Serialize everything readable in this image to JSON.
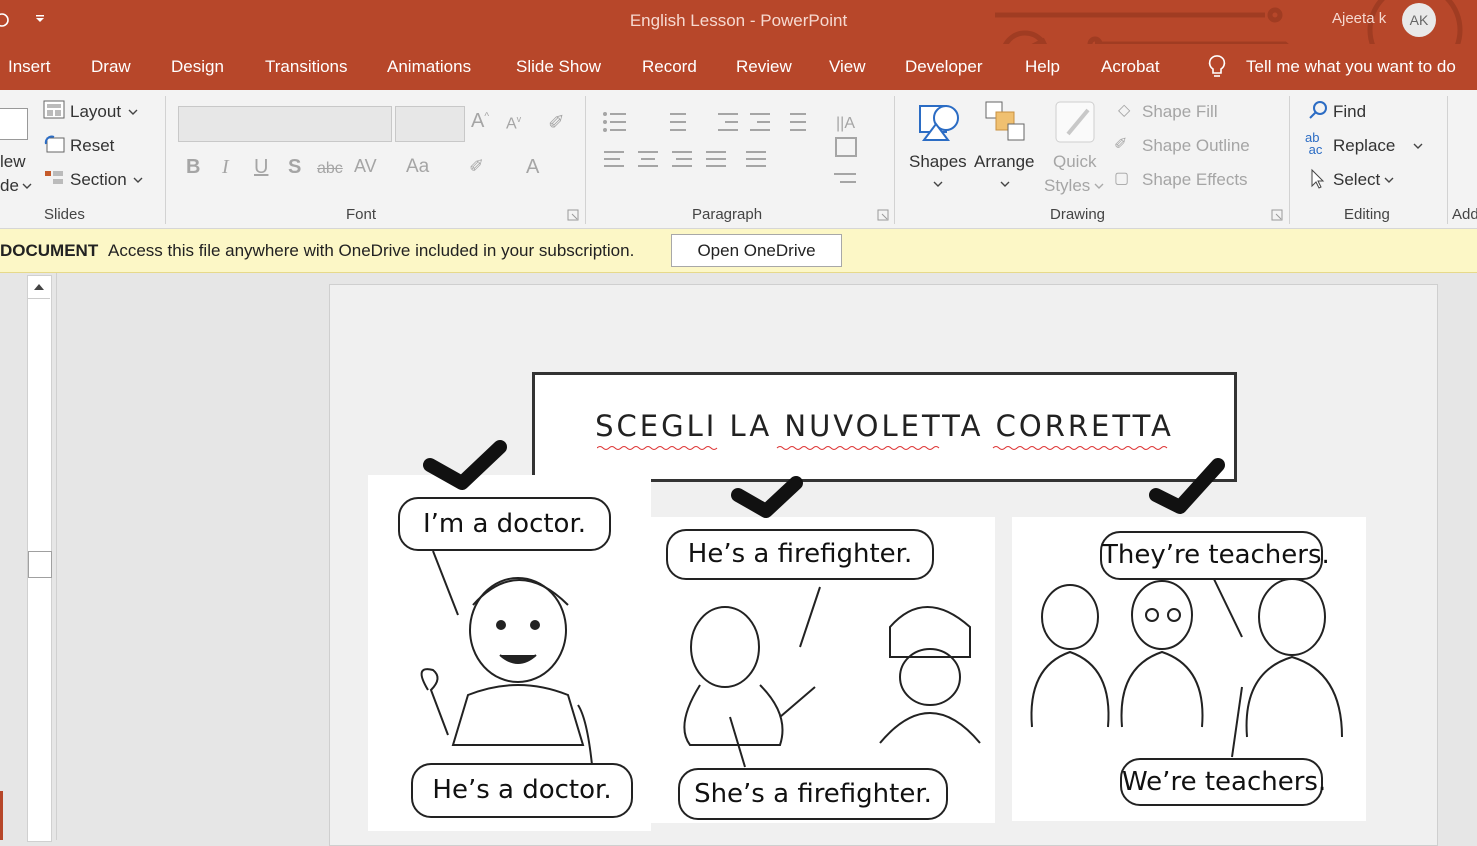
{
  "titlebar": {
    "title": "English Lesson  -  PowerPoint",
    "user_name": "Ajeeta k",
    "avatar_initials": "AK",
    "accent": "#b7472a"
  },
  "tabs": [
    "Insert",
    "Draw",
    "Design",
    "Transitions",
    "Animations",
    "Slide Show",
    "Record",
    "Review",
    "View",
    "Developer",
    "Help",
    "Acrobat"
  ],
  "tell_me": "Tell me what you want to do",
  "ribbon": {
    "slides": {
      "new_slide_line1": "lew",
      "new_slide_line2": "de",
      "layout": "Layout",
      "reset": "Reset",
      "section": "Section",
      "group_label": "Slides"
    },
    "font": {
      "bold": "B",
      "italic": "I",
      "underline": "U",
      "shadow": "S",
      "strike": "abc",
      "spacing": "AV",
      "case": "Aa",
      "color_a": "A",
      "group_label": "Font"
    },
    "paragraph": {
      "group_label": "Paragraph"
    },
    "drawing": {
      "shapes": "Shapes",
      "arrange": "Arrange",
      "quick_styles_1": "Quick",
      "quick_styles_2": "Styles",
      "shape_fill": "Shape Fill",
      "shape_outline": "Shape Outline",
      "shape_effects": "Shape Effects",
      "group_label": "Drawing"
    },
    "editing": {
      "find": "Find",
      "replace": "Replace",
      "select": "Select",
      "group_label": "Editing"
    },
    "next_group_clip": "Add"
  },
  "infobar": {
    "bold_label": "DOCUMENT",
    "message": "Access this file anywhere with OneDrive included in your subscription.",
    "button": "Open OneDrive"
  },
  "slide": {
    "title": "SCEGLI LA NUVOLETTA CORRETTA",
    "panel1": {
      "top_bubble": "I’m a doctor.",
      "bottom_bubble": "He’s a doctor."
    },
    "panel2": {
      "top_bubble": "He’s a firefighter.",
      "bottom_bubble": "She’s a firefighter."
    },
    "panel3": {
      "top_bubble": "They’re teachers.",
      "bottom_bubble": "We’re teachers."
    }
  }
}
